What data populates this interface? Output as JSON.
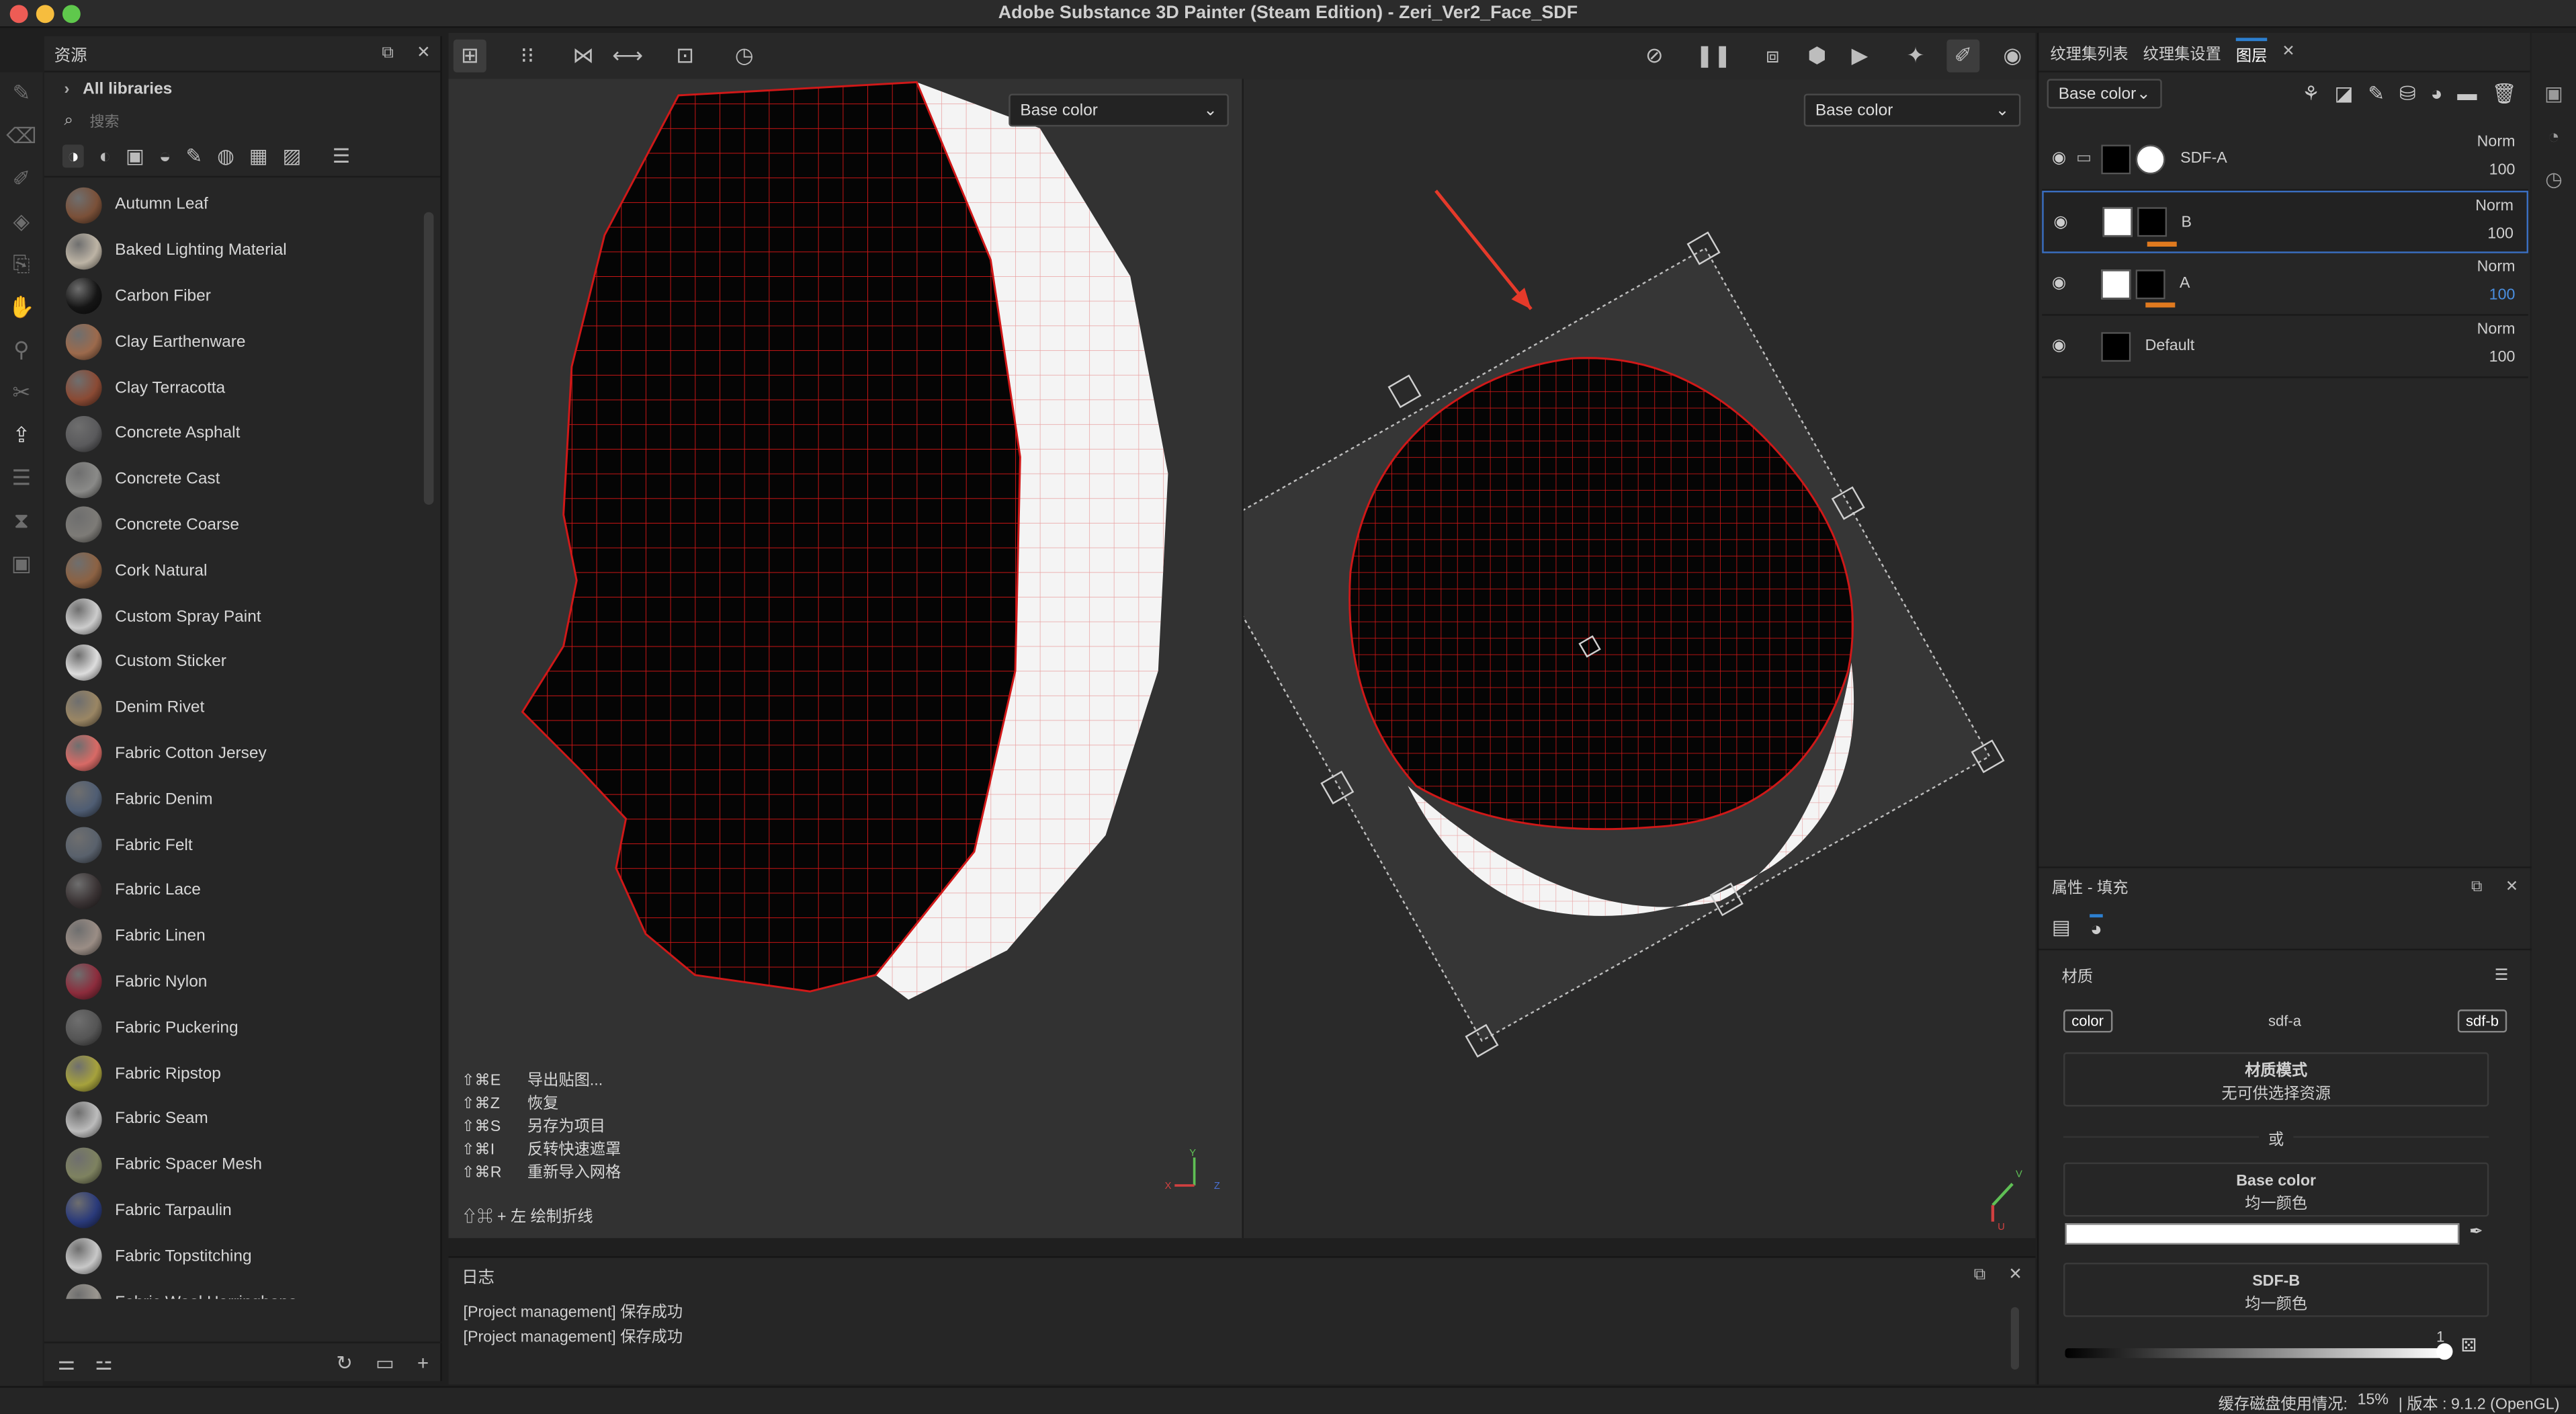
{
  "window": {
    "title": "Adobe Substance 3D Painter (Steam Edition) - Zeri_Ver2_Face_SDF"
  },
  "assets": {
    "title": "资源",
    "library": "All libraries",
    "search_placeholder": "搜索",
    "items": [
      {
        "label": "Autumn Leaf",
        "color": "#7a5038"
      },
      {
        "label": "Baked Lighting Material",
        "color": "#bdb4a5"
      },
      {
        "label": "Carbon Fiber",
        "color": "#151515"
      },
      {
        "label": "Clay Earthenware",
        "color": "#9c6a4c"
      },
      {
        "label": "Clay Terracotta",
        "color": "#8a4a34"
      },
      {
        "label": "Concrete Asphalt",
        "color": "#5a5a5c"
      },
      {
        "label": "Concrete Cast",
        "color": "#8a8a88"
      },
      {
        "label": "Concrete Coarse",
        "color": "#7d7b77"
      },
      {
        "label": "Cork Natural",
        "color": "#8c6243"
      },
      {
        "label": "Custom Spray Paint",
        "color": "#cccccc"
      },
      {
        "label": "Custom Sticker",
        "color": "#dddddd"
      },
      {
        "label": "Denim Rivet",
        "color": "#9a8664"
      },
      {
        "label": "Fabric Cotton Jersey",
        "color": "#d86a66"
      },
      {
        "label": "Fabric Denim",
        "color": "#4f5d73"
      },
      {
        "label": "Fabric Felt",
        "color": "#59616c"
      },
      {
        "label": "Fabric Lace",
        "color": "#3a3334"
      },
      {
        "label": "Fabric Linen",
        "color": "#9a8d85"
      },
      {
        "label": "Fabric Nylon",
        "color": "#8c2c3c"
      },
      {
        "label": "Fabric Puckering",
        "color": "#555555"
      },
      {
        "label": "Fabric Ripstop",
        "color": "#a6a23c"
      },
      {
        "label": "Fabric Seam",
        "color": "#bcbcbc"
      },
      {
        "label": "Fabric Spacer Mesh",
        "color": "#7e8260"
      },
      {
        "label": "Fabric Tarpaulin",
        "color": "#2a3a7a"
      },
      {
        "label": "Fabric Topstitching",
        "color": "#c8c8c8"
      },
      {
        "label": "Fabric Wool Herringbone",
        "color": "#9b9790"
      }
    ]
  },
  "viewport": {
    "left_channel": "Base color",
    "right_channel": "Base color",
    "shortcuts": [
      {
        "keys": "⇧⌘E",
        "action": "导出贴图..."
      },
      {
        "keys": "⇧⌘Z",
        "action": "恢复"
      },
      {
        "keys": "⇧⌘S",
        "action": "另存为项目"
      },
      {
        "keys": "⇧⌘I",
        "action": "反转快速遮罩"
      },
      {
        "keys": "⇧⌘R",
        "action": "重新导入网格"
      }
    ],
    "draw_line_hint": "⇧⌘ + 左  绘制折线"
  },
  "log": {
    "title": "日志",
    "lines": [
      "[Project management] 保存成功",
      "[Project management] 保存成功"
    ]
  },
  "right_tabs": [
    "纹理集列表",
    "纹理集设置",
    "图层"
  ],
  "layers_toolbar": {
    "channel": "Base color"
  },
  "layers": [
    {
      "name": "SDF-A",
      "blend": "Norm",
      "opacity": "100"
    },
    {
      "name": "B",
      "blend": "Norm",
      "opacity": "100"
    },
    {
      "name": "A",
      "blend": "Norm",
      "opacity": "100"
    },
    {
      "name": "Default",
      "blend": "Norm",
      "opacity": "100"
    }
  ],
  "properties": {
    "title": "属性 - 填充",
    "section": "材质",
    "channels": [
      "color",
      "sdf-a",
      "sdf-b"
    ],
    "material_mode_label": "材质模式",
    "material_mode_value": "无可供选择资源",
    "or_label": "或",
    "base_color_label": "Base color",
    "base_color_value": "均一颜色",
    "sdfb_label": "SDF-B",
    "sdfb_value": "均一颜色",
    "slider_value": "1"
  },
  "status": {
    "cache": "缓存磁盘使用情况:",
    "usage": "15%",
    "version": "| 版本 : 9.1.2 (OpenGL)"
  },
  "colors": {
    "accent": "#2d7fd0",
    "mesh": "#c81515",
    "layer_orange": "#e07a1f",
    "close": "#ee5c55",
    "minimize": "#f6bd3e",
    "zoom": "#5fc84c"
  },
  "axis": {
    "x": "X",
    "y": "Y",
    "z": "Z",
    "u": "U",
    "v": "V"
  }
}
